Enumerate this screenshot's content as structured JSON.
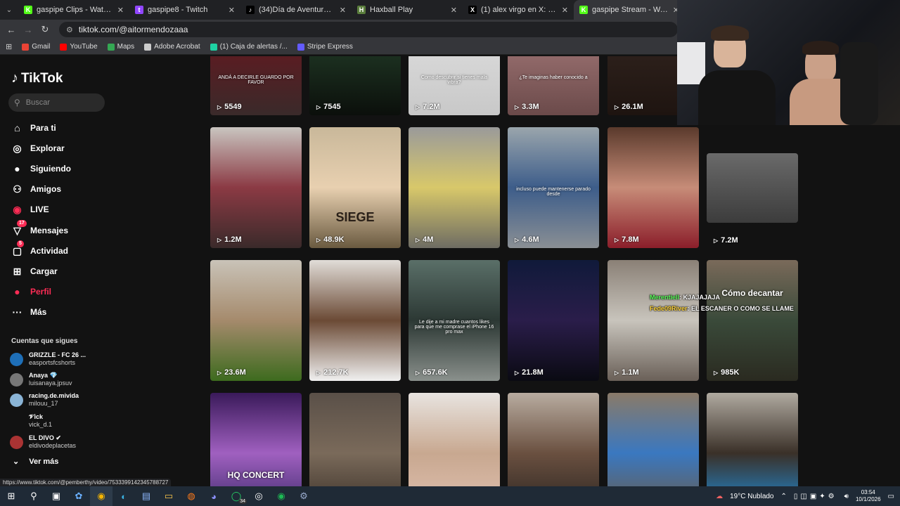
{
  "tabs": [
    {
      "title": "gaspipe Clips - Watch Live on K",
      "fav": "K",
      "color": "#53fc18",
      "active": false
    },
    {
      "title": "gaspipe8 - Twitch",
      "fav": "t",
      "color": "#9146ff",
      "active": false
    },
    {
      "title": "(34)Día de Aventura con Leto e",
      "fav": "♪",
      "color": "#000000",
      "active": false
    },
    {
      "title": "Haxball Play",
      "fav": "H",
      "color": "#5a7d3c",
      "active": false
    },
    {
      "title": "(1) alex virgo en X: \"y esto que",
      "fav": "X",
      "color": "#000000",
      "active": false
    },
    {
      "title": "gaspipe Stream - Watch Live on",
      "fav": "K",
      "color": "#53fc18",
      "active": true
    }
  ],
  "address": "tiktok.com/@aitormendozaaa",
  "bookmarks": [
    {
      "label": "Gmail",
      "color": "#ea4335"
    },
    {
      "label": "YouTube",
      "color": "#ff0000"
    },
    {
      "label": "Maps",
      "color": "#34a853"
    },
    {
      "label": "Adobe Acrobat",
      "color": "#cccccc"
    },
    {
      "label": "(1) Caja de alertas /...",
      "color": "#1ed2a4"
    },
    {
      "label": "Stripe Express",
      "color": "#635bff"
    }
  ],
  "sidebar": {
    "logo": "TikTok",
    "search_placeholder": "Buscar",
    "nav": [
      {
        "label": "Para ti",
        "icon": "home-icon",
        "glyph": "⌂",
        "badge": ""
      },
      {
        "label": "Explorar",
        "icon": "compass-icon",
        "glyph": "◎",
        "badge": ""
      },
      {
        "label": "Siguiendo",
        "icon": "following-avatar-icon",
        "glyph": "●",
        "badge": ""
      },
      {
        "label": "Amigos",
        "icon": "friends-icon",
        "glyph": "⚇",
        "badge": ""
      },
      {
        "label": "LIVE",
        "icon": "live-icon",
        "glyph": "◉",
        "badge": ""
      },
      {
        "label": "Mensajes",
        "icon": "messages-icon",
        "glyph": "▽",
        "badge": "17"
      },
      {
        "label": "Actividad",
        "icon": "activity-icon",
        "glyph": "▢",
        "badge": "5"
      },
      {
        "label": "Cargar",
        "icon": "upload-icon",
        "glyph": "⊞",
        "badge": ""
      },
      {
        "label": "Perfil",
        "icon": "profile-icon",
        "glyph": "●",
        "badge": ""
      },
      {
        "label": "Más",
        "icon": "more-icon",
        "glyph": "···",
        "badge": ""
      }
    ],
    "following_title": "Cuentas que sigues",
    "following": [
      {
        "name": "GRIZZLE - FC 26 ...",
        "handle": "easportsfcshorts",
        "color": "#1e6fb8"
      },
      {
        "name": "Anaya 💎",
        "handle": "luisanaya.jpsuv",
        "color": "#777"
      },
      {
        "name": "racing.de.mivida",
        "handle": "milouu_17",
        "color": "#8ab4d6"
      },
      {
        "name": "𝓥ick",
        "handle": "vick_d.1",
        "color": ""
      },
      {
        "name": "EL DIVO ✔",
        "handle": "eldivodeplacetas",
        "color": "#a33"
      }
    ],
    "see_more": "Ver más"
  },
  "videos": [
    [
      {
        "views": "5549",
        "bg": "linear-gradient(180deg,#7a0f1a,#3a2a2a)",
        "caption": "ANDÁ A DECIRLE GUARDO POR FAVOR"
      },
      {
        "views": "7545",
        "bg": "linear-gradient(180deg,#0c140c,#1c3020,#0b0f0b)",
        "caption": ""
      },
      {
        "views": "7.2M",
        "bg": "linear-gradient(180deg,#e6e6e6,#c8c8c8)",
        "caption": "Como descubrir si tienes mala vibra?"
      },
      {
        "views": "3.3M",
        "bg": "linear-gradient(180deg,#b98a8a,#6b4a4a)",
        "caption": "¿Te imaginas haber conocido a"
      },
      {
        "views": "26.1M",
        "bg": "linear-gradient(180deg,#3a2b25,#1e1410)",
        "caption": ""
      }
    ],
    [
      {
        "views": "1.2M",
        "bg": "linear-gradient(180deg,#c9c5c0,#8b3a44,#3a2a2a)",
        "caption": ""
      },
      {
        "views": "48.9K",
        "bg": "linear-gradient(180deg,#c9b89a,#e8d0b0,#6a5a40)",
        "caption": "SIEGE"
      },
      {
        "views": "4M",
        "bg": "linear-gradient(180deg,#9a9a9a,#d8c86a,#6e6c63)",
        "caption": ""
      },
      {
        "views": "4.6M",
        "bg": "linear-gradient(180deg,#9aa5ac,#3d5d8a,#8a8f94)",
        "caption": "incluso puede mantenerse parado desde"
      },
      {
        "views": "7.8M",
        "bg": "linear-gradient(180deg,#5a3a2c,#c78c78,#8b1e2a)",
        "caption": ""
      },
      {
        "views": "7.2M",
        "bg": "linear-gradient(180deg,#6a6a6a,#3c3c3c)",
        "caption": ""
      }
    ],
    [
      {
        "views": "23.6M",
        "bg": "linear-gradient(180deg,#c9c3b8,#a58a6c,#3d6b1e)",
        "caption": ""
      },
      {
        "views": "212.7K",
        "bg": "linear-gradient(180deg,#e1ddd8,#6b4a35,#f0f0f0)",
        "caption": ""
      },
      {
        "views": "657.6K",
        "bg": "linear-gradient(180deg,#5a6f68,#2c3834,#8a908c)",
        "caption": "Le dije a mi madre cuantos likes para que me comprase el iPhone 16 pro max"
      },
      {
        "views": "21.8M",
        "bg": "linear-gradient(180deg,#101a3a,#2a1d4a,#0a0a12)",
        "caption": ""
      },
      {
        "views": "1.1M",
        "bg": "linear-gradient(180deg,#8a8076,#c8c4bc,#6a6058)",
        "caption": ""
      },
      {
        "views": "985K",
        "bg": "linear-gradient(180deg,#7a6a5a,#3a4a3a,#2a2a20)",
        "caption": "Cómo decantar"
      }
    ],
    [
      {
        "views": "",
        "bg": "linear-gradient(180deg,#3a1a5a,#a060c0,#3a2a6a)",
        "caption": "HQ CONCERT"
      },
      {
        "views": "",
        "bg": "linear-gradient(180deg,#5a5048,#7a6a5a,#3a3028)",
        "caption": ""
      },
      {
        "views": "",
        "bg": "linear-gradient(180deg,#e8e4e0,#c8a890,#e0c0b0)",
        "caption": ""
      },
      {
        "views": "",
        "bg": "linear-gradient(180deg,#b8aca0,#6a5040,#2a2420)",
        "caption": ""
      },
      {
        "views": "",
        "bg": "linear-gradient(180deg,#8a7a68,#3a78c0,#6a5a48)",
        "caption": ""
      },
      {
        "views": "",
        "bg": "linear-gradient(180deg,#b0aaa0,#3a3028,#1e90e0)",
        "caption": ""
      }
    ]
  ],
  "chat_overlay": [
    {
      "user": "Merentiell",
      "msg": ": KJAJAJAJA"
    },
    {
      "user": "Fede09River",
      "msg": ": EL ESCANER O COMO SE LLAME"
    }
  ],
  "status_url": "https://www.tiktok.com/@pemberthy/video/7533399142345788727",
  "taskbar": {
    "weather": "19°C  Nublado",
    "time": "03:54",
    "date": "10/1/2026",
    "whatsapp_badge": "34"
  }
}
